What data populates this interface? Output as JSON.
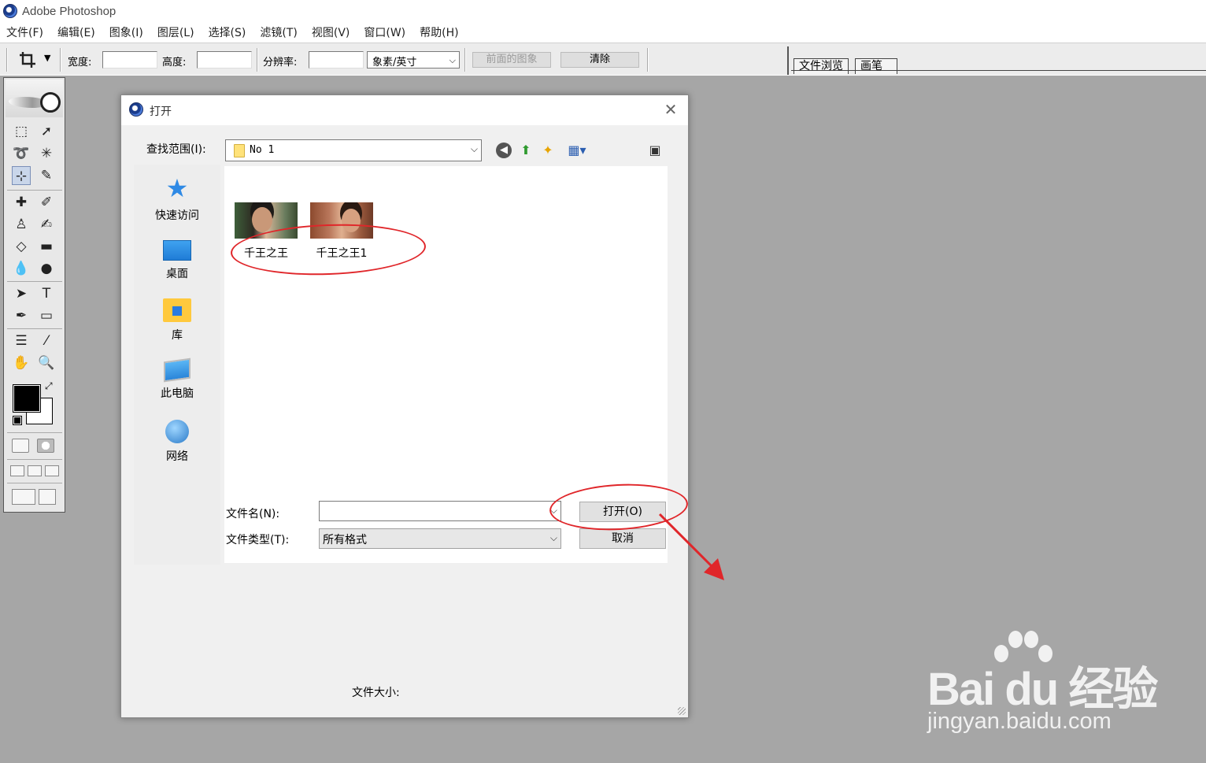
{
  "app": {
    "title": "Adobe Photoshop"
  },
  "menu": [
    "文件(F)",
    "编辑(E)",
    "图象(I)",
    "图层(L)",
    "选择(S)",
    "滤镜(T)",
    "视图(V)",
    "窗口(W)",
    "帮助(H)"
  ],
  "options": {
    "width_label": "宽度:",
    "height_label": "高度:",
    "resolution_label": "分辨率:",
    "unit_value": "象素/英寸",
    "front_image_label": "前面的图象",
    "clear_label": "清除",
    "palette_tabs": [
      "文件浏览",
      "画笔"
    ]
  },
  "dialog": {
    "title": "打开",
    "look_in_label": "查找范围(I):",
    "look_in_value": "No 1",
    "places": [
      {
        "label": "快速访问",
        "icon": "star-icon"
      },
      {
        "label": "桌面",
        "icon": "desktop-icon"
      },
      {
        "label": "库",
        "icon": "library-icon"
      },
      {
        "label": "此电脑",
        "icon": "computer-icon"
      },
      {
        "label": "网络",
        "icon": "network-icon"
      }
    ],
    "files": [
      {
        "name": "千王之王"
      },
      {
        "name": "千王之王1"
      }
    ],
    "filename_label": "文件名(N):",
    "filename_value": "",
    "filetype_label": "文件类型(T):",
    "filetype_value": "所有格式",
    "open_button": "打开(O)",
    "cancel_button": "取消",
    "filesize_label": "文件大小:"
  },
  "colors": {
    "workspace": "#a6a6a6",
    "annotation": "#e0262a",
    "foreground_swatch": "#000000",
    "background_swatch": "#ffffff"
  },
  "watermark": {
    "brand": "Bai du 经验",
    "url": "jingyan.baidu.com"
  }
}
